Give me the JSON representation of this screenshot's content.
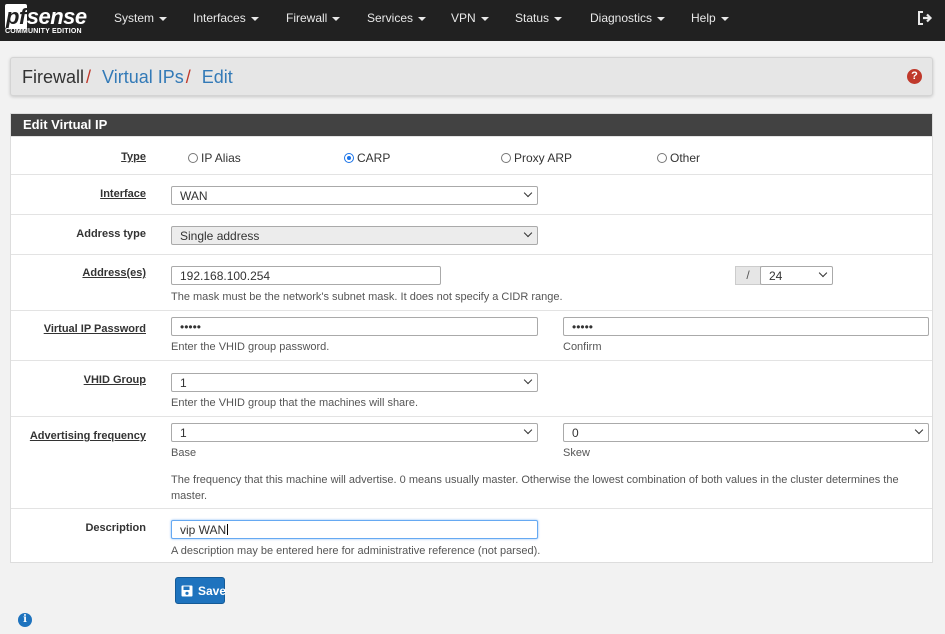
{
  "logo": {
    "pf": "pf",
    "sense": "sense",
    "edition": "COMMUNITY EDITION"
  },
  "nav": [
    "System",
    "Interfaces",
    "Firewall",
    "Services",
    "VPN",
    "Status",
    "Diagnostics",
    "Help"
  ],
  "breadcrumb": {
    "root": "Firewall",
    "section": "Virtual IPs",
    "page": "Edit"
  },
  "panel_title": "Edit Virtual IP",
  "form": {
    "type": {
      "label": "Type",
      "options": [
        {
          "label": "IP Alias",
          "checked": false
        },
        {
          "label": "CARP",
          "checked": true
        },
        {
          "label": "Proxy ARP",
          "checked": false
        },
        {
          "label": "Other",
          "checked": false
        }
      ]
    },
    "interface": {
      "label": "Interface",
      "value": "WAN"
    },
    "address_type": {
      "label": "Address type",
      "value": "Single address"
    },
    "address": {
      "label": "Address(es)",
      "value": "192.168.100.254",
      "slash": "/",
      "mask": "24",
      "help": "The mask must be the network's subnet mask. It does not specify a CIDR range."
    },
    "vip_password": {
      "label": "Virtual IP Password",
      "value": "•••••",
      "confirm_value": "•••••",
      "help": "Enter the VHID group password.",
      "confirm_help": "Confirm"
    },
    "vhid_group": {
      "label": "VHID Group",
      "value": "1",
      "help": "Enter the VHID group that the machines will share."
    },
    "advertising": {
      "label": "Advertising frequency",
      "base_value": "1",
      "base_help": "Base",
      "skew_value": "0",
      "skew_help": "Skew",
      "help": "The frequency that this machine will advertise. 0 means usually master. Otherwise the lowest combination of both values in the cluster determines the master."
    },
    "description": {
      "label": "Description",
      "value": "vip WAN",
      "help": "A description may be entered here for administrative reference (not parsed)."
    }
  },
  "save_label": "Save",
  "colors": {
    "navbar": "#212121",
    "accent_red": "#c0392b",
    "link_blue": "#337ab7",
    "button_blue": "#1e73be",
    "panel_heading": "#424242"
  }
}
